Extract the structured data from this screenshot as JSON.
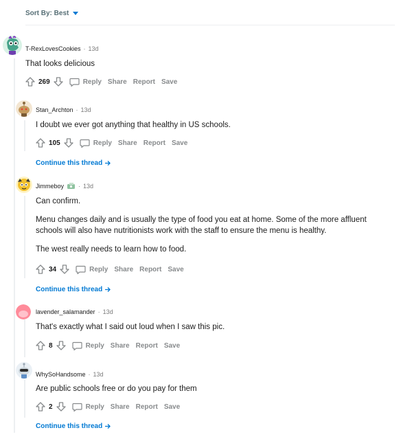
{
  "sort": {
    "label": "Sort By: Best"
  },
  "comments": [
    {
      "username": "T-RexLovesCookies",
      "time": "13d",
      "paragraphs": [
        "That looks delicious"
      ],
      "score": "269",
      "actions": {
        "reply": "Reply",
        "share": "Share",
        "report": "Report",
        "save": "Save"
      }
    },
    {
      "username": "Stan_Archton",
      "time": "13d",
      "paragraphs": [
        "I doubt we ever got anything that healthy in US schools."
      ],
      "score": "105",
      "actions": {
        "reply": "Reply",
        "share": "Share",
        "report": "Report",
        "save": "Save"
      },
      "continue": "Continue this thread"
    },
    {
      "username": "Jimmeboy",
      "time": "13d",
      "paragraphs": [
        "Can confirm.",
        "Menu changes daily and is usually the type of food you eat at home. Some of the more affluent schools will also have nutritionists work with the staff to ensure the menu is healthy.",
        "The west really needs to learn how to food."
      ],
      "score": "34",
      "actions": {
        "reply": "Reply",
        "share": "Share",
        "report": "Report",
        "save": "Save"
      },
      "continue": "Continue this thread"
    },
    {
      "username": "lavender_salamander",
      "time": "13d",
      "paragraphs": [
        "That's exactly what I said out loud when I saw this pic."
      ],
      "score": "8",
      "actions": {
        "reply": "Reply",
        "share": "Share",
        "report": "Report",
        "save": "Save"
      }
    },
    {
      "username": "WhySoHandsome",
      "time": "13d",
      "paragraphs": [
        "Are public schools free or do you pay for them"
      ],
      "score": "2",
      "actions": {
        "reply": "Reply",
        "share": "Share",
        "report": "Report",
        "save": "Save"
      },
      "continue": "Continue this thread"
    }
  ],
  "dot": "·",
  "icons": {
    "upvote": "upvote-icon",
    "downvote": "downvote-icon",
    "reply": "reply-bubble-icon",
    "arrow": "arrow-right-icon"
  },
  "colors": {
    "link": "#0079d3",
    "muted": "#878a8c",
    "line": "#edeff1"
  }
}
